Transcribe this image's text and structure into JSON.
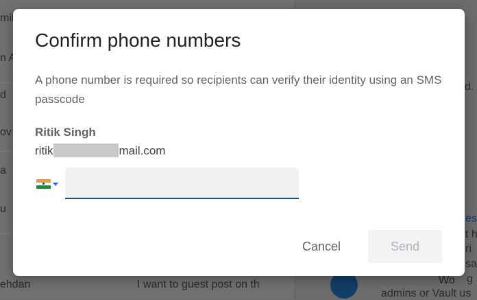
{
  "dialog": {
    "title": "Confirm phone numbers",
    "description": "A phone number is required so recipients can verify their identity using an SMS passcode",
    "recipient": {
      "name": "Ritik Singh",
      "email_prefix": "ritik",
      "email_suffix": "mail.com"
    },
    "country": {
      "icon": "india-flag-icon",
      "code": "IN"
    },
    "phone": {
      "value": "",
      "placeholder": ""
    },
    "buttons": {
      "cancel": "Cancel",
      "send": "Send"
    }
  },
  "background": {
    "fragments_left": [
      "mili",
      "n A",
      "d",
      "ov",
      "a",
      "u",
      "ehdan",
      "I want to guest post on th"
    ],
    "fragments_right": [
      "d.",
      "es",
      "t h",
      "ri",
      "sa",
      "g",
      "Wo",
      "admins or Vault us"
    ]
  },
  "colors": {
    "accent": "#1a4f86",
    "title": "#202124",
    "secondary_text": "#5f6368",
    "disabled_button_bg": "#f1f3f4",
    "disabled_button_text": "#b0b3b6",
    "overlay": "#6b6b6b"
  }
}
